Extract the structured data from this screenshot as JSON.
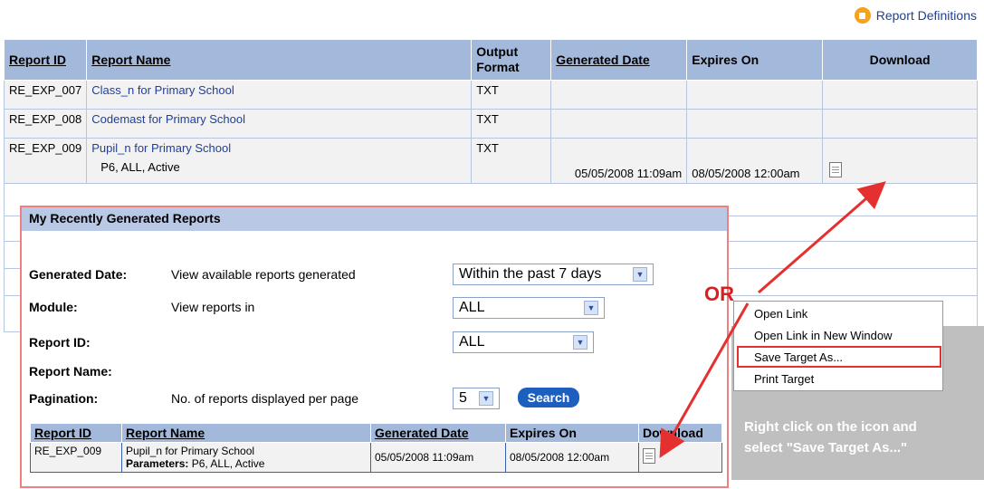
{
  "top_link": {
    "label": "Report Definitions"
  },
  "main_table": {
    "headers": {
      "id": "Report ID",
      "name": "Report Name",
      "format": "Output Format",
      "gen": "Generated Date",
      "exp": "Expires On",
      "dl": "Download"
    },
    "rows": [
      {
        "id": "RE_EXP_007",
        "name": "Class_n for Primary School",
        "format": "TXT"
      },
      {
        "id": "RE_EXP_008",
        "name": "Codemast for Primary School",
        "format": "TXT"
      },
      {
        "id": "RE_EXP_009",
        "name": "Pupil_n for Primary School",
        "format": "TXT",
        "params": "P6, ALL, Active",
        "generated": "05/05/2008 11:09am",
        "expires": "08/05/2008 12:00am"
      }
    ]
  },
  "panel": {
    "title": "My Recently Generated Reports",
    "fields": {
      "generated_label": "Generated Date:",
      "generated_desc": "View available reports generated",
      "generated_value": "Within the past 7 days",
      "module_label": "Module:",
      "module_desc": "View reports in",
      "module_value": "ALL",
      "reportid_label": "Report ID:",
      "reportid_value": "ALL",
      "reportname_label": "Report Name:",
      "pagination_label": "Pagination:",
      "pagination_desc": "No. of reports displayed per page",
      "pagination_value": "5"
    },
    "search_label": "Search",
    "results": {
      "headers": {
        "id": "Report ID",
        "name": "Report Name",
        "gen": "Generated Date",
        "exp": "Expires On",
        "dl": "Download"
      },
      "row": {
        "id": "RE_EXP_009",
        "name": "Pupil_n for Primary School",
        "params_label": "Parameters:",
        "params": "P6, ALL, Active",
        "generated": "05/05/2008 11:09am",
        "expires": "08/05/2008 12:00am"
      }
    }
  },
  "annotation": {
    "or": "OR",
    "menu": [
      "Open Link",
      "Open Link in New Window",
      "Save Target As...",
      "Print Target"
    ],
    "note_line1": "Right click on the icon and",
    "note_line2": "select \"Save Target As...\""
  },
  "colors": {
    "header_bg": "#a3b9dc",
    "link": "#1f3f99",
    "highlight": "#e53030",
    "arrow": "#e53030"
  }
}
